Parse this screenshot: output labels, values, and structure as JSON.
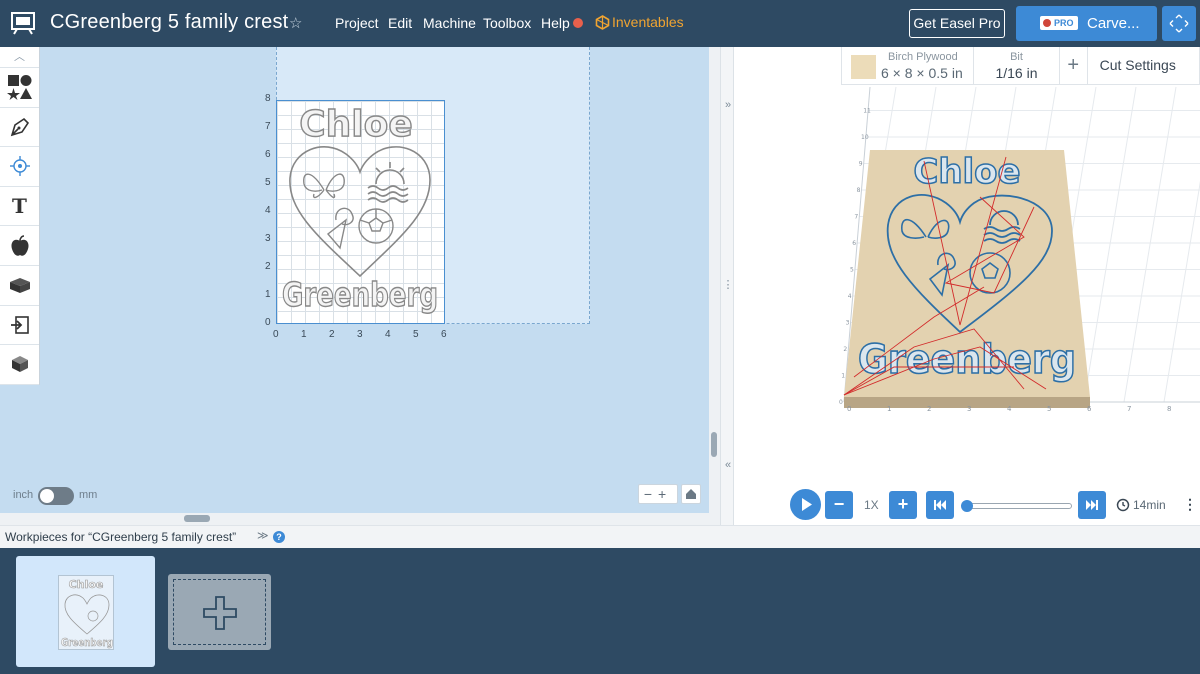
{
  "header": {
    "title": "CGreenberg 5 family crest",
    "star_icon": "star-outline-icon",
    "menu": [
      {
        "label": "Project"
      },
      {
        "label": "Edit"
      },
      {
        "label": "Machine"
      },
      {
        "label": "Toolbox"
      },
      {
        "label": "Help"
      }
    ],
    "inventables_label": "Inventables",
    "get_pro_label": "Get Easel Pro",
    "pro_badge": "PRO",
    "carve_label": "Carve...",
    "colors": {
      "accent": "#3d8ad6",
      "topbar": "#2e4a63",
      "inventables": "#f0a431",
      "alert": "#e8604c"
    }
  },
  "design": {
    "y_ticks": [
      "8",
      "7",
      "6",
      "5",
      "4",
      "3",
      "2",
      "1",
      "0"
    ],
    "x_ticks": [
      "0",
      "1",
      "2",
      "3",
      "4",
      "5",
      "6"
    ],
    "top_text": "Chloe",
    "bottom_text": "Greenberg",
    "unit_left": "inch",
    "unit_right": "mm",
    "zoom_label": "−+"
  },
  "preview": {
    "material_name": "Birch Plywood",
    "material_dims": "6 × 8 × 0.5 in",
    "bit_label": "Bit",
    "bit_value": "1/16 in",
    "add_label": "+",
    "cut_settings_label": "Cut Settings",
    "speed": "1X",
    "eta": "14min",
    "x_ticks": [
      "0",
      "1",
      "2",
      "3",
      "4",
      "5",
      "6",
      "7",
      "8"
    ],
    "y_ticks": [
      "0",
      "1",
      "2",
      "3",
      "4",
      "5",
      "6",
      "7",
      "8",
      "9",
      "10",
      "11"
    ],
    "top_text": "Chloe",
    "bottom_text": "Greenberg"
  },
  "workpieces": {
    "title": "Workpieces for “CGreenberg 5 family crest”",
    "chevron": "≫",
    "help": "?",
    "thumb_top": "Chloe",
    "thumb_bottom": "Greenberg"
  }
}
